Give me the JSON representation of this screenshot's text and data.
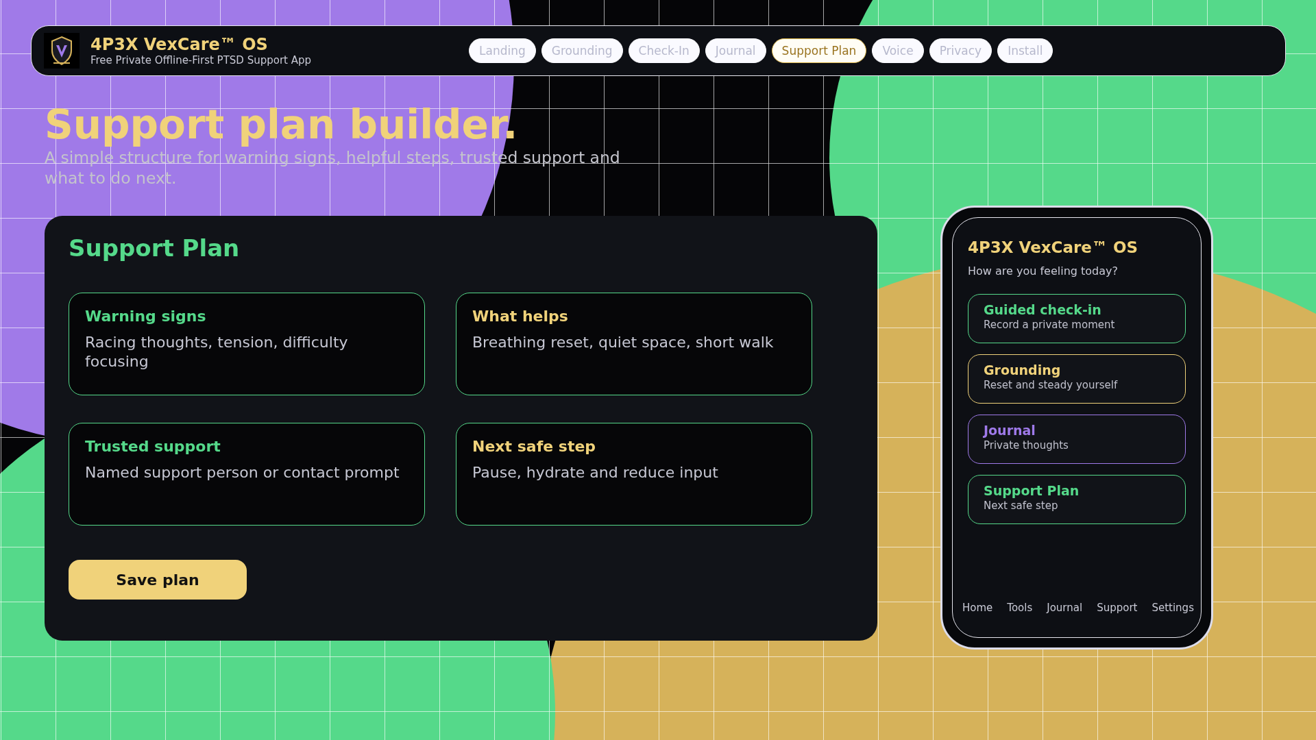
{
  "header": {
    "app_name": "4P3X VexCare™ OS",
    "tagline": "Free Private Offline-First PTSD Support App"
  },
  "nav": [
    {
      "label": "Landing",
      "selected": false
    },
    {
      "label": "Grounding",
      "selected": false
    },
    {
      "label": "Check-In",
      "selected": false
    },
    {
      "label": "Journal",
      "selected": false
    },
    {
      "label": "Support Plan",
      "selected": true
    },
    {
      "label": "Voice",
      "selected": false
    },
    {
      "label": "Privacy",
      "selected": false
    },
    {
      "label": "Install",
      "selected": false
    }
  ],
  "hero": {
    "title": "Support plan builder.",
    "subtitle": "A simple structure for warning signs, helpful steps, trusted support and what to do next."
  },
  "plan": {
    "title": "Support Plan",
    "sections": [
      {
        "title": "Warning signs",
        "text": "Racing thoughts, tension, difficulty focusing",
        "color": "#55d98a"
      },
      {
        "title": "What helps",
        "text": "Breathing reset, quiet space, short walk",
        "color": "#f0d27a"
      },
      {
        "title": "Trusted support",
        "text": "Named support person or contact prompt",
        "color": "#55d98a"
      },
      {
        "title": "Next safe step",
        "text": "Pause, hydrate and reduce input",
        "color": "#f0d27a"
      }
    ],
    "save_button": "Save plan"
  },
  "phone": {
    "app_name": "4P3X VexCare™ OS",
    "prompt": "How are you feeling today?",
    "tiles": [
      {
        "title": "Guided check-in",
        "subtitle": "Record a private moment",
        "color": "#55d98a"
      },
      {
        "title": "Grounding",
        "subtitle": "Reset and steady yourself",
        "color": "#f0d27a"
      },
      {
        "title": "Journal",
        "subtitle": "Private thoughts",
        "color": "#9f7aea"
      },
      {
        "title": "Support Plan",
        "subtitle": "Next safe step",
        "color": "#55d98a"
      }
    ],
    "tabbar": [
      "Home",
      "Tools",
      "Journal",
      "Support",
      "Settings"
    ]
  }
}
